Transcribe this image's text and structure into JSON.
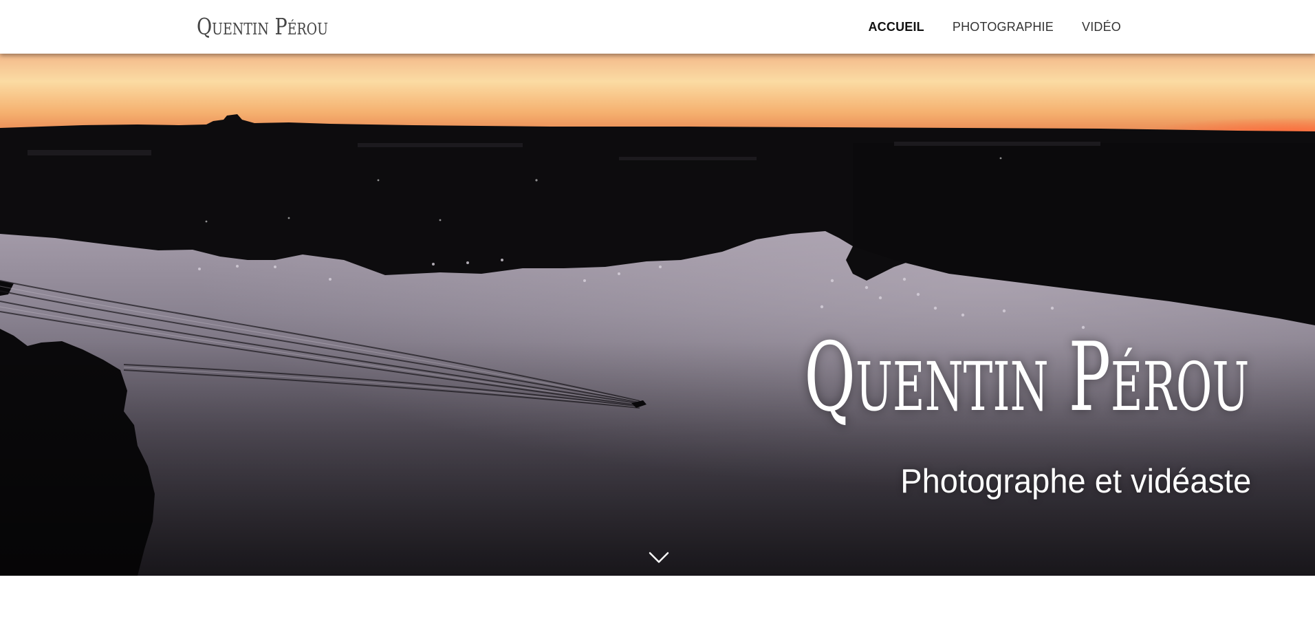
{
  "header": {
    "logo_text": "Quentin Pérou",
    "nav": [
      {
        "label": "ACCUEIL",
        "active": true
      },
      {
        "label": "PHOTOGRAPHIE",
        "active": false
      },
      {
        "label": "VIDÉO",
        "active": false
      }
    ]
  },
  "hero": {
    "title": "Quentin Pérou",
    "subtitle": "Photographe et vidéaste",
    "scroll_icon": "chevron-down-icon"
  },
  "colors": {
    "sky_top": "#f7c77e",
    "sky_horizon": "#ff8a4c",
    "land": "#0c0b0c",
    "water": "#6a6473",
    "header_bg": "#ffffff",
    "text_light": "#ffffff",
    "nav_text": "#333333"
  }
}
